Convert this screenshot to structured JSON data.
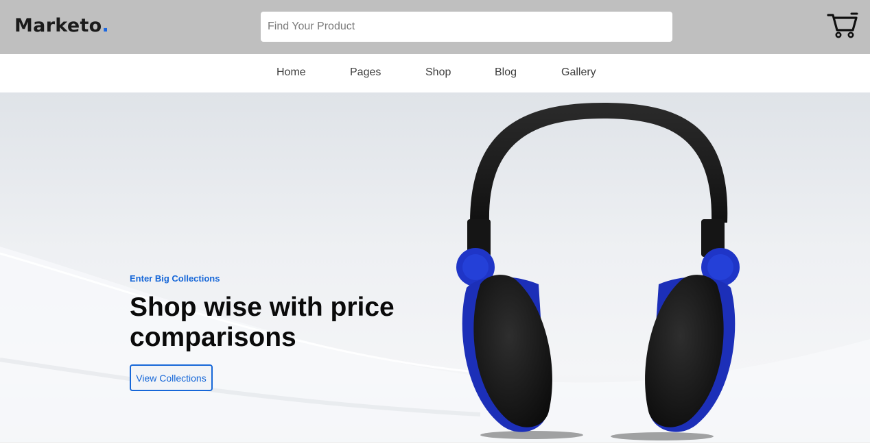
{
  "header": {
    "logo_text": "Marketo",
    "logo_dot": ".",
    "search_placeholder": "Find Your Product",
    "cart_icon": "shopping-cart-icon"
  },
  "nav": {
    "items": [
      "Home",
      "Pages",
      "Shop",
      "Blog",
      "Gallery"
    ]
  },
  "hero": {
    "eyebrow": "Enter Big Collections",
    "headline": "Shop wise with price comparisons",
    "cta_label": "View Collections",
    "image": "headphones-image"
  },
  "colors": {
    "accent": "#1667d8",
    "header_bg": "#bfbfbf",
    "headphone_blue": "#1f35c7"
  }
}
